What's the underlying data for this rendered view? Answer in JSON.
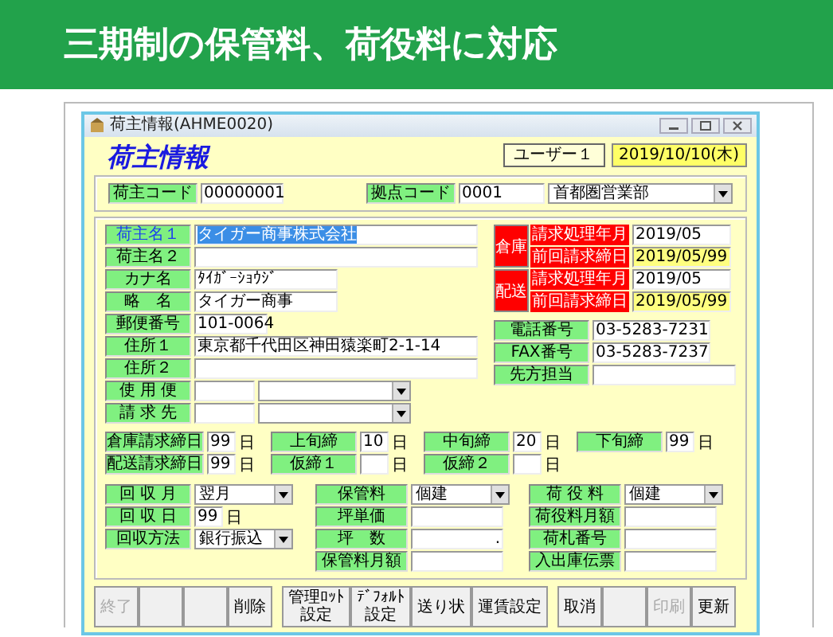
{
  "banner": {
    "title": "三期制の保管料、荷役料に対応"
  },
  "window": {
    "title": "荷主情報(AHME0020)"
  },
  "header": {
    "heading": "荷主情報",
    "user": "ユーザー１",
    "date": "2019/10/10(木)"
  },
  "top_fields": [
    {
      "label": "荷主コード",
      "value": "00000001"
    },
    {
      "label": "拠点コード",
      "value": "0001",
      "option": "首都圏営業部"
    }
  ],
  "customer_fields": [
    {
      "label": "荷主名１",
      "value": "タイガー商事株式会社",
      "kind": "text",
      "selected": true
    },
    {
      "label": "荷主名２",
      "kind": "text",
      "selected": false
    },
    {
      "label": "カナ名",
      "value": "ﾀｲｶﾞｰｼｮｳｼﾞ",
      "kind": "text",
      "selected": false
    },
    {
      "label": "略　名",
      "value": "タイガー商事",
      "kind": "text",
      "selected": false
    },
    {
      "label": "郵便番号",
      "value": "101-0064",
      "kind": "text",
      "selected": false
    },
    {
      "label": "住所１",
      "value": "東京都千代田区神田猿楽町2-1-14",
      "kind": "text",
      "selected": false
    },
    {
      "label": "住所２",
      "kind": "text",
      "selected": false
    },
    {
      "label": "使 用 便",
      "kind": "combo",
      "selected": false
    },
    {
      "label": "請 求 先",
      "kind": "combo",
      "selected": false
    }
  ],
  "billing": [
    {
      "group": "倉庫",
      "rows": [
        {
          "label": "請求処理年月",
          "value": "2019/05",
          "highlight": false
        },
        {
          "label": "前回請求締日",
          "value": "2019/05/99",
          "highlight": true
        }
      ]
    },
    {
      "group": "配送",
      "rows": [
        {
          "label": "請求処理年月",
          "value": "2019/05",
          "highlight": false
        },
        {
          "label": "前回請求締日",
          "value": "2019/05/99",
          "highlight": true
        }
      ]
    }
  ],
  "contact_fields": [
    {
      "label": "電話番号",
      "value": "03-5283-7231"
    },
    {
      "label": "FAX番号",
      "value": "03-5283-7237"
    },
    {
      "label": "先方担当"
    }
  ],
  "closing_rows": [
    [
      {
        "label": "倉庫請求締日",
        "value": "99",
        "unit": "日"
      },
      {
        "label": "上旬締",
        "value": "10",
        "unit": "日"
      },
      {
        "label": "中旬締",
        "value": "20",
        "unit": "日"
      },
      {
        "label": "下旬締",
        "value": "99",
        "unit": "日"
      }
    ],
    [
      {
        "label": "配送請求締日",
        "value": "99",
        "unit": "日"
      },
      {
        "label": "仮締１",
        "unit": "日"
      },
      {
        "label": "仮締２",
        "unit": "日"
      }
    ]
  ],
  "columns": [
    [
      {
        "label": "回 収 月",
        "kind": "select",
        "value": "翌月"
      },
      {
        "label": "回 収 日",
        "kind": "day",
        "value": "99",
        "unit": "日"
      },
      {
        "label": "回収方法",
        "kind": "select",
        "value": "銀行振込"
      }
    ],
    [
      {
        "label": "保管料",
        "kind": "select",
        "value": "個建"
      },
      {
        "label": "坪単価",
        "kind": "text"
      },
      {
        "label": "坪　数",
        "kind": "text",
        "value": "."
      },
      {
        "label": "保管料月額",
        "kind": "text"
      }
    ],
    [
      {
        "label": "荷 役 料",
        "kind": "select",
        "value": "個建"
      },
      {
        "label": "荷役料月額",
        "kind": "text"
      },
      {
        "label": "荷札番号",
        "kind": "text"
      },
      {
        "label": "入出庫伝票",
        "kind": "text"
      }
    ]
  ],
  "buttons": [
    [
      {
        "kind": "label",
        "lines": [
          "終了"
        ],
        "disabled": true
      },
      {
        "kind": "blank"
      },
      {
        "kind": "blank"
      },
      {
        "kind": "label",
        "lines": [
          "削除"
        ],
        "disabled": false
      }
    ],
    [
      {
        "kind": "label",
        "lines": [
          "管理ﾛｯﾄ",
          "設定"
        ],
        "disabled": false
      },
      {
        "kind": "label",
        "lines": [
          "ﾃﾞﾌｫﾙﾄ",
          "設定"
        ],
        "disabled": false
      },
      {
        "kind": "label",
        "lines": [
          "送り状"
        ],
        "disabled": false
      },
      {
        "kind": "label",
        "lines": [
          "運賃設定"
        ],
        "disabled": false
      }
    ],
    [
      {
        "kind": "label",
        "lines": [
          "取消"
        ],
        "disabled": false
      },
      {
        "kind": "blank"
      },
      {
        "kind": "label",
        "lines": [
          "印刷"
        ],
        "disabled": true
      },
      {
        "kind": "label",
        "lines": [
          "更新"
        ],
        "disabled": false
      }
    ]
  ]
}
